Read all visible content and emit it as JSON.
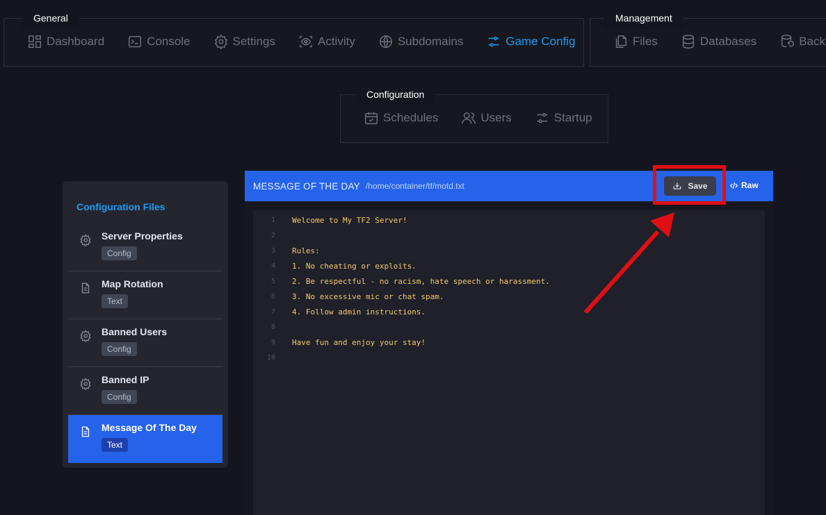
{
  "nav_general": {
    "label": "General",
    "items": [
      {
        "label": "Dashboard",
        "icon": "dashboard-icon"
      },
      {
        "label": "Console",
        "icon": "console-icon"
      },
      {
        "label": "Settings",
        "icon": "settings-icon"
      },
      {
        "label": "Activity",
        "icon": "activity-icon"
      },
      {
        "label": "Subdomains",
        "icon": "globe-icon"
      },
      {
        "label": "Game Config",
        "icon": "sliders-icon",
        "active": true
      }
    ]
  },
  "nav_management": {
    "label": "Management",
    "items": [
      {
        "label": "Files",
        "icon": "files-icon"
      },
      {
        "label": "Databases",
        "icon": "database-icon"
      },
      {
        "label": "Backu",
        "icon": "backup-icon"
      }
    ]
  },
  "nav_configuration": {
    "label": "Configuration",
    "items": [
      {
        "label": "Schedules",
        "icon": "calendar-icon"
      },
      {
        "label": "Users",
        "icon": "users-icon"
      },
      {
        "label": "Startup",
        "icon": "sliders-icon"
      }
    ]
  },
  "sidebar": {
    "title": "Configuration Files",
    "files": [
      {
        "name": "Server Properties",
        "badge": "Config",
        "icon": "gear-icon"
      },
      {
        "name": "Map Rotation",
        "badge": "Text",
        "icon": "document-icon"
      },
      {
        "name": "Banned Users",
        "badge": "Config",
        "icon": "gear-icon"
      },
      {
        "name": "Banned IP",
        "badge": "Config",
        "icon": "gear-icon"
      },
      {
        "name": "Message Of The Day",
        "badge": "Text",
        "icon": "document-icon",
        "active": true
      }
    ]
  },
  "editor": {
    "title": "MESSAGE OF THE DAY",
    "path": "/home/container/tf/motd.txt",
    "save_label": "Save",
    "raw_label": "Raw",
    "lines": [
      {
        "n": "1",
        "text": "Welcome to My TF2 Server!"
      },
      {
        "n": "2",
        "text": ""
      },
      {
        "n": "3",
        "text": "Rules:"
      },
      {
        "n": "4",
        "text": "1. No cheating or exploits."
      },
      {
        "n": "5",
        "text": "2. Be respectful - no racism, hate speech or harassment."
      },
      {
        "n": "6",
        "text": "3. No excessive mic or chat spam."
      },
      {
        "n": "7",
        "text": "4. Follow admin instructions."
      },
      {
        "n": "8",
        "text": ""
      },
      {
        "n": "9",
        "text": "Have fun and enjoy your stay!"
      },
      {
        "n": "10",
        "text": ""
      }
    ]
  },
  "colors": {
    "accent": "#2563eb",
    "nav_active": "#1e9bf0",
    "highlight": "#e00f14",
    "code_text": "#f2c96b"
  }
}
